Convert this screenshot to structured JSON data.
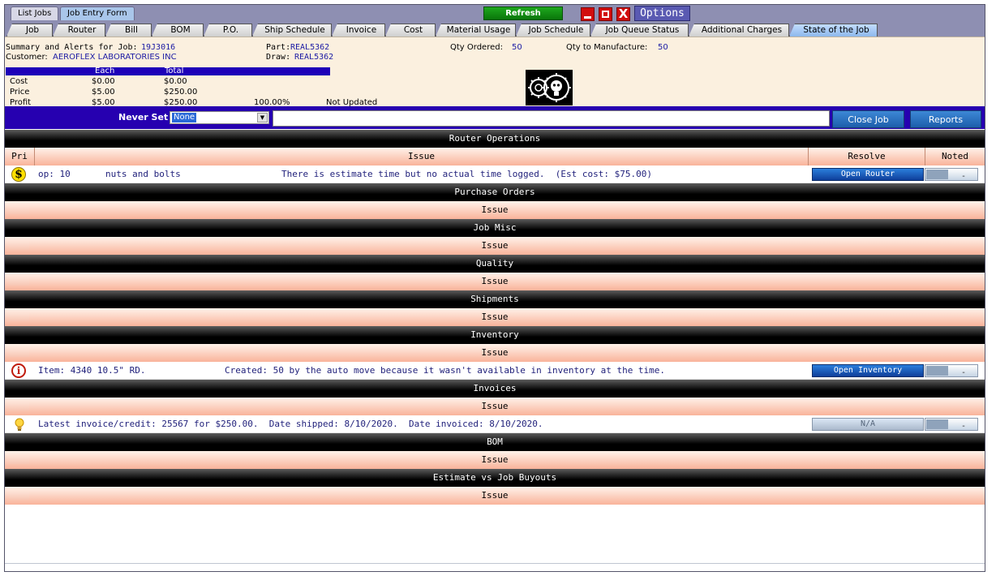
{
  "top_tabs": [
    "List Jobs",
    "Job Entry Form"
  ],
  "toolbar": {
    "refresh_label": "Refresh",
    "close_glyph": "X",
    "options_label": "Options"
  },
  "tabs": [
    "Job",
    "Router",
    "Bill",
    "BOM",
    "P.O.",
    "Ship Schedule",
    "Invoice",
    "Cost",
    "Material Usage",
    "Job Schedule",
    "Job Queue Status",
    "Additional Charges",
    "State of the Job"
  ],
  "summary": {
    "title_label": "Summary and Alerts for Job:",
    "job": "19J3016",
    "customer_label": "Customer:",
    "customer": "AEROFLEX LABORATORIES INC",
    "part_label": "Part:",
    "part": "REAL5362",
    "draw_label": "Draw:",
    "draw": "REAL5362",
    "qty_ordered_label": "Qty Ordered:",
    "qty_ordered": "50",
    "qty_manufacture_label": "Qty to Manufacture:",
    "qty_manufacture": "50",
    "each_header": "Each",
    "total_header": "Total",
    "cost_label": "Cost",
    "cost_each": "$0.00",
    "cost_total": "$0.00",
    "price_label": "Price",
    "price_each": "$5.00",
    "price_total": "$250.00",
    "profit_label": "Profit",
    "profit_each": "$5.00",
    "profit_total": "$250.00",
    "profit_pct": "100.00%",
    "status": "Not Updated"
  },
  "setbar": {
    "label": "Never Set",
    "dropdown_value": "None",
    "close_job": "Close Job",
    "reports": "Reports"
  },
  "headers": {
    "pri": "Pri",
    "issue": "Issue",
    "resolve": "Resolve",
    "noted": "Noted"
  },
  "sections": {
    "router": "Router Operations",
    "purchase_orders": "Purchase Orders",
    "job_misc": "Job Misc",
    "quality": "Quality",
    "shipments": "Shipments",
    "inventory": "Inventory",
    "invoices": "Invoices",
    "bom": "BOM",
    "estimate": "Estimate vs Job Buyouts"
  },
  "rows": {
    "router": {
      "op": "op: 10",
      "desc": "nuts and bolts",
      "issue": "There is estimate time but no actual time logged.  (Est cost: $75.00)",
      "button": "Open Router",
      "noted": "-"
    },
    "inventory": {
      "item": "Item: 4340 10.5\" RD.",
      "issue": "Created: 50 by the auto move because it wasn't available in inventory at the time.",
      "button": "Open Inventory",
      "noted": "-"
    },
    "invoice": {
      "issue": "Latest invoice/credit: 25567 for $250.00.  Date shipped: 8/10/2020.  Date invoiced: 8/10/2020.",
      "button": "N/A",
      "noted": "-"
    }
  },
  "icons": {
    "dollar": "$",
    "info": "i"
  }
}
